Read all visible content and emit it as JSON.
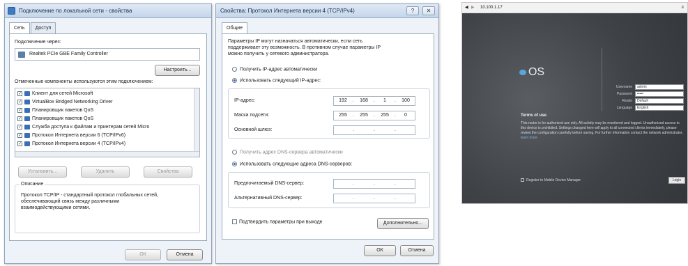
{
  "win1": {
    "title": "Подключение по локальной сети - свойства",
    "tabs": [
      "Сеть",
      "Доступ"
    ],
    "connect_via_label": "Подключение через:",
    "adapter_name": "Realtek PCIe GBE Family Controller",
    "configure_button": "Настроить...",
    "components_label": "Отмеченные компоненты используются этим подключением:",
    "components": [
      {
        "label": "Клиент для сетей Microsoft",
        "checked": true
      },
      {
        "label": "VirtualBox Bridged Networking Driver",
        "checked": true
      },
      {
        "label": "Планировщик пакетов QoS",
        "checked": true
      },
      {
        "label": "Планировщик пакетов QoS",
        "checked": true
      },
      {
        "label": "Служба доступа к файлам и принтерам сетей Micro",
        "checked": true
      },
      {
        "label": "Протокол Интернета версии 6 (TCP/IPv6)",
        "checked": true
      },
      {
        "label": "Протокол Интернета версии 4 (TCP/IPv4)",
        "checked": true
      }
    ],
    "install_button": "Установить...",
    "remove_button": "Удалить",
    "properties_button": "Свойства",
    "description_title": "Описание",
    "description_text": "Протокол TCP/IP - стандартный протокол глобальных сетей, обеспечивающий связь между различными взаимодействующими сетями.",
    "ok_button": "ОК",
    "cancel_button": "Отмена"
  },
  "win2": {
    "title": "Свойства: Протокол Интернета версии 4 (TCP/IPv4)",
    "help_glyph": "?",
    "close_glyph": "✕",
    "tab": "Общие",
    "intro_text": "Параметры IP могут назначаться автоматически, если сеть поддерживает эту возможность. В противном случае параметры IP можно получить у сетевого администратора.",
    "auto_ip_label": "Получить IP-адрес автоматически",
    "manual_ip_label": "Использовать следующий IP-адрес:",
    "ip_label": "IP-адрес:",
    "ip_value": [
      "192",
      "168",
      "1",
      "100"
    ],
    "mask_label": "Маска подсети:",
    "mask_value": [
      "255",
      "255",
      "255",
      "0"
    ],
    "gateway_label": "Основной шлюз:",
    "auto_dns_label": "Получить адрес DNS-сервера автоматически",
    "manual_dns_label": "Использовать следующие адреса DNS-серверов:",
    "preferred_dns_label": "Предпочитаемый DNS-сервер:",
    "alternate_dns_label": "Альтернативный DNS-сервер:",
    "validate_label": "Подтвердить параметры при выходе",
    "advanced_button": "Дополнительно...",
    "ok_button": "ОК",
    "cancel_button": "Отмена"
  },
  "browser": {
    "url": "10.100.1.17",
    "logo_text": "OS",
    "form_labels": [
      "Username",
      "Password",
      "Realm",
      "Language"
    ],
    "form_values": [
      "admin",
      "•••••",
      "Default",
      "English"
    ],
    "heading": "Terms of use",
    "body_text": "This router is for authorized use only. All activity may be monitored and logged. Unauthorized access to this device is prohibited. Settings changed here will apply to all connected clients immediately, please review the configuration carefully before saving. For further information contact the network administrator.",
    "link_text": "learn more",
    "remember_label": "Register to Mobile Device Manager",
    "login_button": "Login"
  },
  "colors": {
    "accent": "#3d7bc4",
    "dark_page": "#3f4247",
    "logo": "#58a6e0"
  }
}
